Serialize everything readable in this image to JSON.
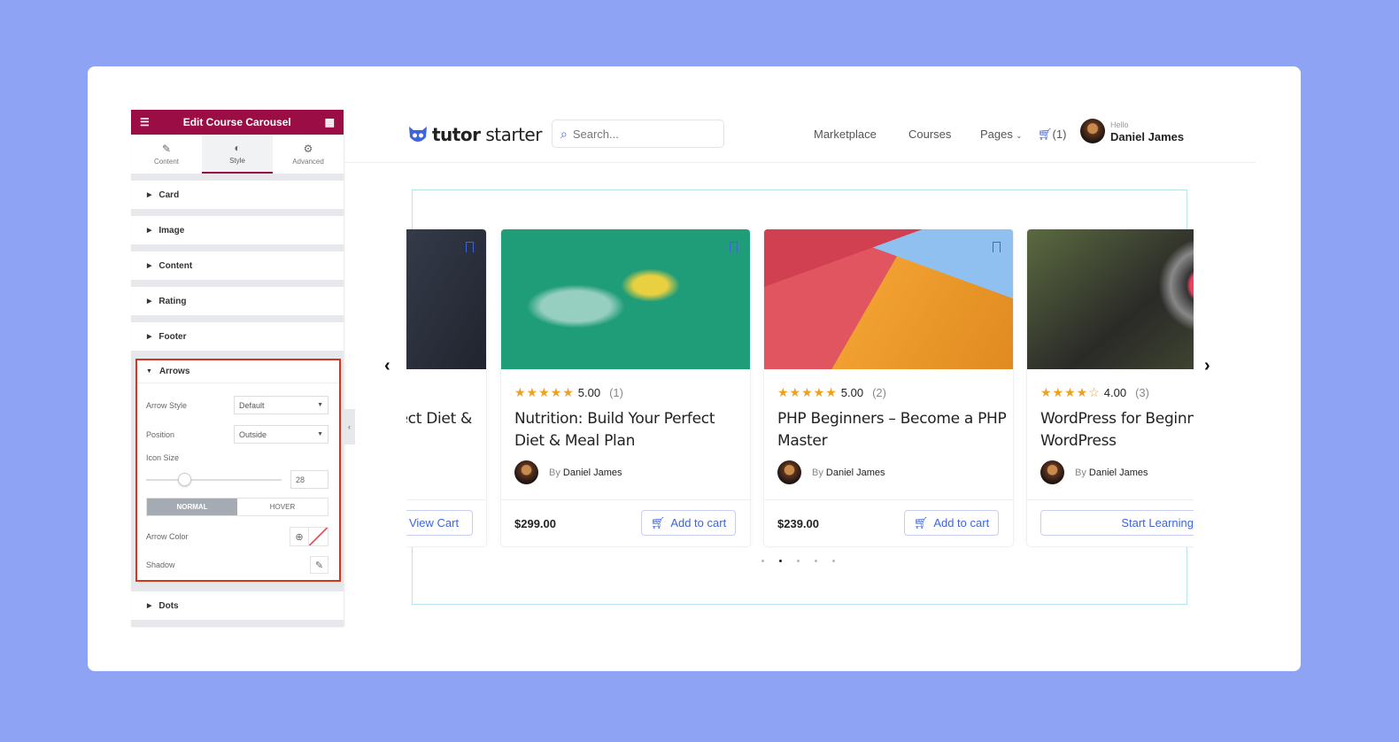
{
  "colors": {
    "background": "#8fa3f5",
    "panel_header": "#9b0d45",
    "accent": "#3e64de",
    "star": "#f0a020",
    "highlight_border": "#d2361e"
  },
  "editor": {
    "title": "Edit Course Carousel",
    "tabs": [
      {
        "label": "Content",
        "icon": "pencil-icon"
      },
      {
        "label": "Style",
        "icon": "contrast-icon",
        "active": true
      },
      {
        "label": "Advanced",
        "icon": "gear-icon"
      }
    ],
    "sections": [
      "Card",
      "Image",
      "Content",
      "Rating",
      "Footer"
    ],
    "arrows": {
      "label": "Arrows",
      "arrow_style_label": "Arrow Style",
      "arrow_style_value": "Default",
      "position_label": "Position",
      "position_value": "Outside",
      "icon_size_label": "Icon Size",
      "icon_size_value": "28",
      "icon_size_slider_fraction": 0.28,
      "state_tabs": [
        "NORMAL",
        "HOVER"
      ],
      "arrow_color_label": "Arrow Color",
      "shadow_label": "Shadow"
    },
    "dots_section": "Dots"
  },
  "site": {
    "logo": {
      "bold": "tutor",
      "rest": " starter"
    },
    "search_placeholder": "Search...",
    "nav": [
      "Marketplace",
      "Courses",
      "Pages"
    ],
    "cart_count": "(1)",
    "greeting": "Hello",
    "user_name": "Daniel James"
  },
  "courses": [
    {
      "title": "ect Diet &",
      "button": "View Cart"
    },
    {
      "rating": "5.00",
      "count": "(1)",
      "stars": 5,
      "title": "Nutrition: Build Your Perfect Diet & Meal Plan",
      "by": "By",
      "author": "Daniel James",
      "price": "$299.00",
      "button": "Add to cart"
    },
    {
      "rating": "5.00",
      "count": "(2)",
      "stars": 5,
      "title": "PHP Beginners – Become a PHP Master",
      "by": "By",
      "author": "Daniel James",
      "price": "$239.00",
      "button": "Add to cart"
    },
    {
      "rating": "4.00",
      "count": "(3)",
      "stars": 4,
      "title": "WordPress for Beginners – Master WordPress",
      "by": "By",
      "author": "Daniel James",
      "button": "Start Learning"
    }
  ],
  "pagination": {
    "total": 5,
    "active": 2
  }
}
